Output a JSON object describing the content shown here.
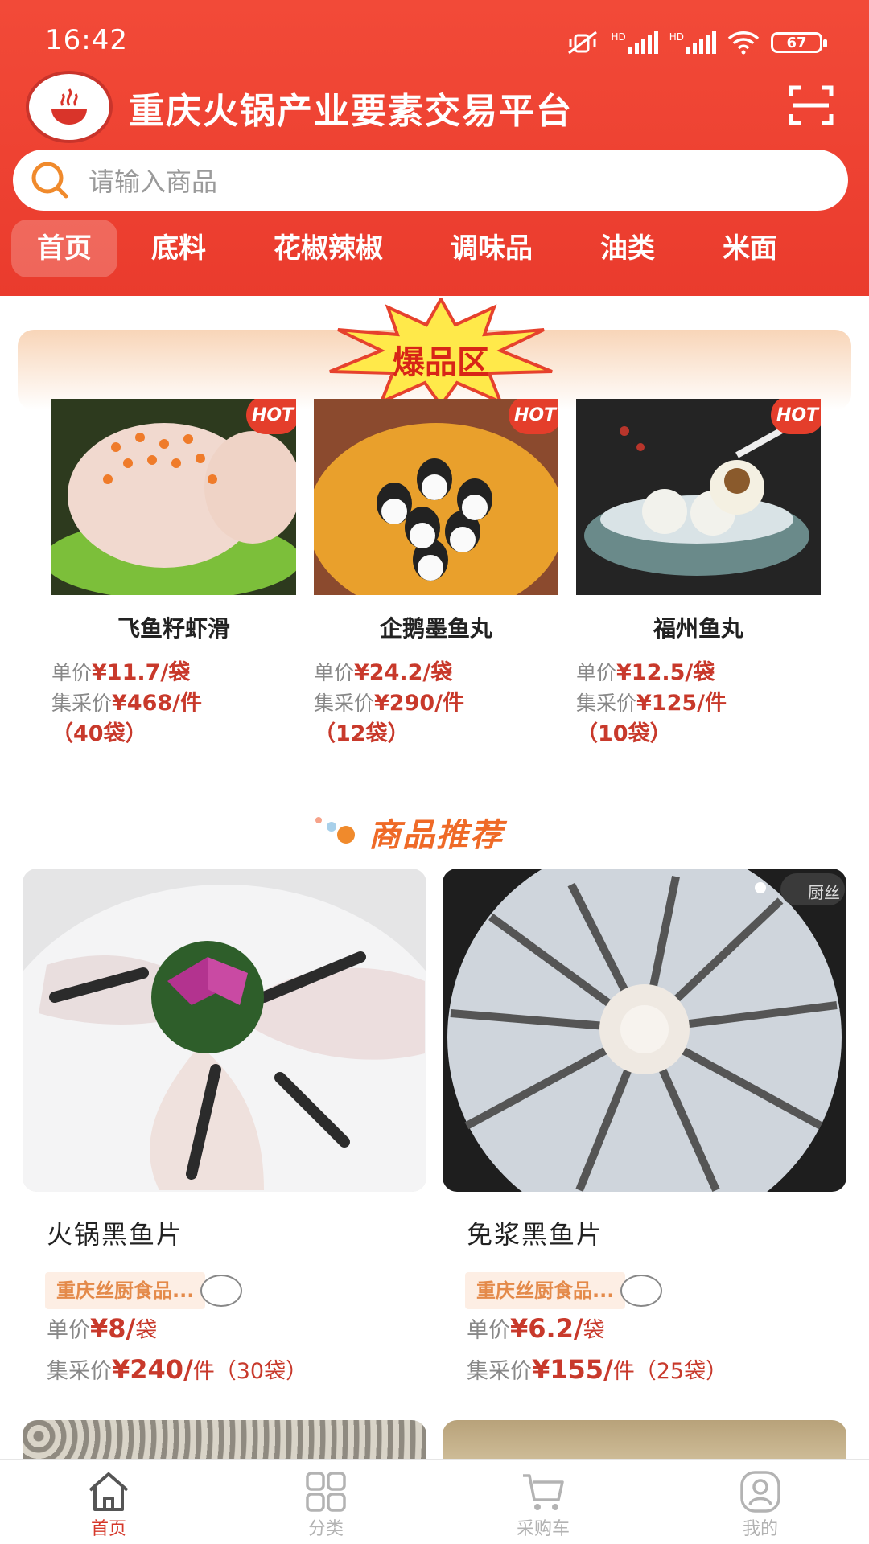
{
  "status": {
    "time": "16:42",
    "battery": "67",
    "hd1": "HD",
    "hd2": "HD"
  },
  "app": {
    "title": "重庆火锅产业要素交易平台"
  },
  "search": {
    "placeholder": "请输入商品"
  },
  "tabs": [
    "首页",
    "底料",
    "花椒辣椒",
    "调味品",
    "油类",
    "米面"
  ],
  "hot_zone": {
    "title": "爆品区",
    "badge": "HOT",
    "items": [
      {
        "name": "飞鱼籽虾滑",
        "unit_label": "单价",
        "unit_price": "¥11.7/袋",
        "bulk_label": "集采价",
        "bulk_price": "¥468/件",
        "bulk_note": "（40袋）"
      },
      {
        "name": "企鹅墨鱼丸",
        "unit_label": "单价",
        "unit_price": "¥24.2/袋",
        "bulk_label": "集采价",
        "bulk_price": "¥290/件",
        "bulk_note": "（12袋）"
      },
      {
        "name": "福州鱼丸",
        "unit_label": "单价",
        "unit_price": "¥12.5/袋",
        "bulk_label": "集采价",
        "bulk_price": "¥125/件",
        "bulk_note": "（10袋）"
      }
    ]
  },
  "recommend": {
    "title": "商品推荐",
    "products": [
      {
        "name": "火锅黑鱼片",
        "shop": "重庆丝厨食品...",
        "unit_label": "单价",
        "unit_price": "¥8/",
        "unit": "袋",
        "bulk_label": "集采价",
        "bulk_price": "¥240/",
        "bulk_unit": "件（30袋）"
      },
      {
        "name": "免浆黑鱼片",
        "shop": "重庆丝厨食品...",
        "unit_label": "单价",
        "unit_price": "¥6.2/",
        "unit": "袋",
        "bulk_label": "集采价",
        "bulk_price": "¥155/",
        "bulk_unit": "件（25袋）",
        "watermark": "厨丝"
      }
    ]
  },
  "tabbar": [
    {
      "label": "首页",
      "icon": "home-icon",
      "active": true
    },
    {
      "label": "分类",
      "icon": "grid-icon",
      "active": false
    },
    {
      "label": "采购车",
      "icon": "cart-icon",
      "active": false
    },
    {
      "label": "我的",
      "icon": "user-icon",
      "active": false
    }
  ],
  "colors": {
    "brand": "#ea3b2d",
    "price": "#c8392b",
    "accent": "#ef6a27"
  }
}
